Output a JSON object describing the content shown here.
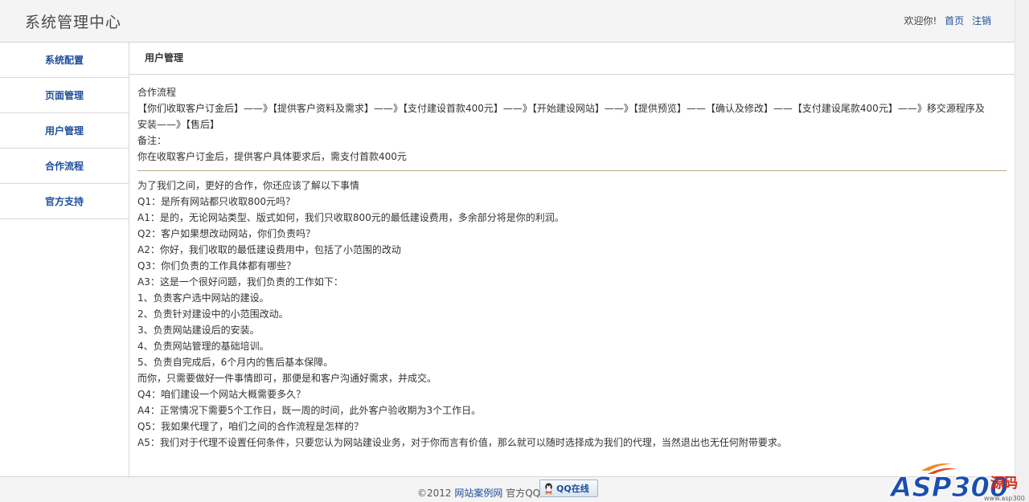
{
  "header": {
    "title": "系统管理中心",
    "welcome": "欢迎你!",
    "home_link": "首页",
    "logout_link": "注销"
  },
  "sidebar": {
    "items": [
      {
        "label": "系统配置"
      },
      {
        "label": "页面管理"
      },
      {
        "label": "用户管理"
      },
      {
        "label": "合作流程"
      },
      {
        "label": "官方支持"
      }
    ]
  },
  "main": {
    "title": "用户管理",
    "intro": [
      "合作流程",
      "【你们收取客户订金后】——》【提供客户资料及需求】——》【支付建设首款400元】——》【开始建设网站】——》【提供预览】——【确认及修改】——【支付建设尾款400元】——》移交源程序及",
      "安装——》【售后】",
      "备注：",
      "你在收取客户订金后，提供客户具体要求后，需支付首款400元"
    ],
    "faq": [
      "为了我们之间，更好的合作，你还应该了解以下事情",
      "Q1：是所有网站都只收取800元吗？",
      "A1：是的，无论网站类型、版式如何，我们只收取800元的最低建设费用，多余部分将是你的利润。",
      "Q2：客户如果想改动网站，你们负责吗？",
      "A2：你好，我们收取的最低建设费用中，包括了小范围的改动",
      "Q3：你们负责的工作具体都有哪些？",
      "A3：这是一个很好问题，我们负责的工作如下：",
      "1、负责客户选中网站的建设。",
      "2、负责针对建设中的小范围改动。",
      "3、负责网站建设后的安装。",
      "4、负责网站管理的基础培训。",
      "5、负责自完成后，6个月内的售后基本保障。",
      "而你，只需要做好一件事情即可，那便是和客户沟通好需求，并成交。",
      "Q4：咱们建设一个网站大概需要多久？",
      "A4：正常情况下需要5个工作日，既一周的时间，此外客户验收期为3个工作日。",
      "Q5：我如果代理了，咱们之间的合作流程是怎样的？",
      "A5：我们对于代理不设置任何条件，只要您认为网站建设业务，对于你而言有价值，那么就可以随时选择成为我们的代理，当然退出也无任何附带要求。"
    ]
  },
  "footer": {
    "copyright_prefix": "©2012",
    "site_link": "网站案例网",
    "official_qq": "官方QQ",
    "qq_button": "QQ在线"
  },
  "watermark": {
    "text": "ASP300源码",
    "domain": "www.asp300.com"
  },
  "colors": {
    "link": "#1f4e9c",
    "divider": "#b8a98a",
    "header_bg": "#f4f4f4"
  }
}
